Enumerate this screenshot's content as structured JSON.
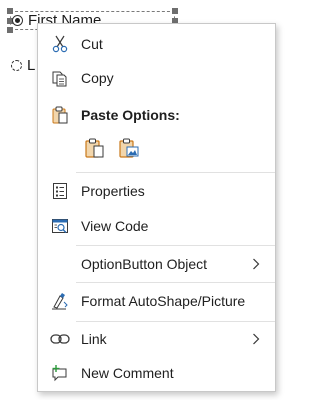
{
  "sheet": {
    "option_first_label": "First Name",
    "option_second_label": "L"
  },
  "menu": {
    "cut": "Cut",
    "copy": "Copy",
    "paste_options_header": "Paste Options:",
    "properties": "Properties",
    "view_code": "View Code",
    "option_button_object": "OptionButton Object",
    "format_autoshape": "Format AutoShape/Picture",
    "link": "Link",
    "new_comment": "New Comment"
  },
  "icons": {
    "cut": "scissors-icon",
    "copy": "copy-icon",
    "paste_options": "clipboard-icon",
    "paste_keep": "paste-keep-formatting-icon",
    "paste_picture": "paste-picture-icon",
    "properties": "properties-icon",
    "view_code": "view-code-icon",
    "format": "format-shape-icon",
    "link": "link-icon",
    "new_comment": "new-comment-icon",
    "submenu": "chevron-right-icon"
  },
  "colors": {
    "accent_orange": "#c9781a",
    "accent_blue": "#2b6cb3",
    "menu_border": "#c8c8c8",
    "separator": "#e1e1e1"
  }
}
